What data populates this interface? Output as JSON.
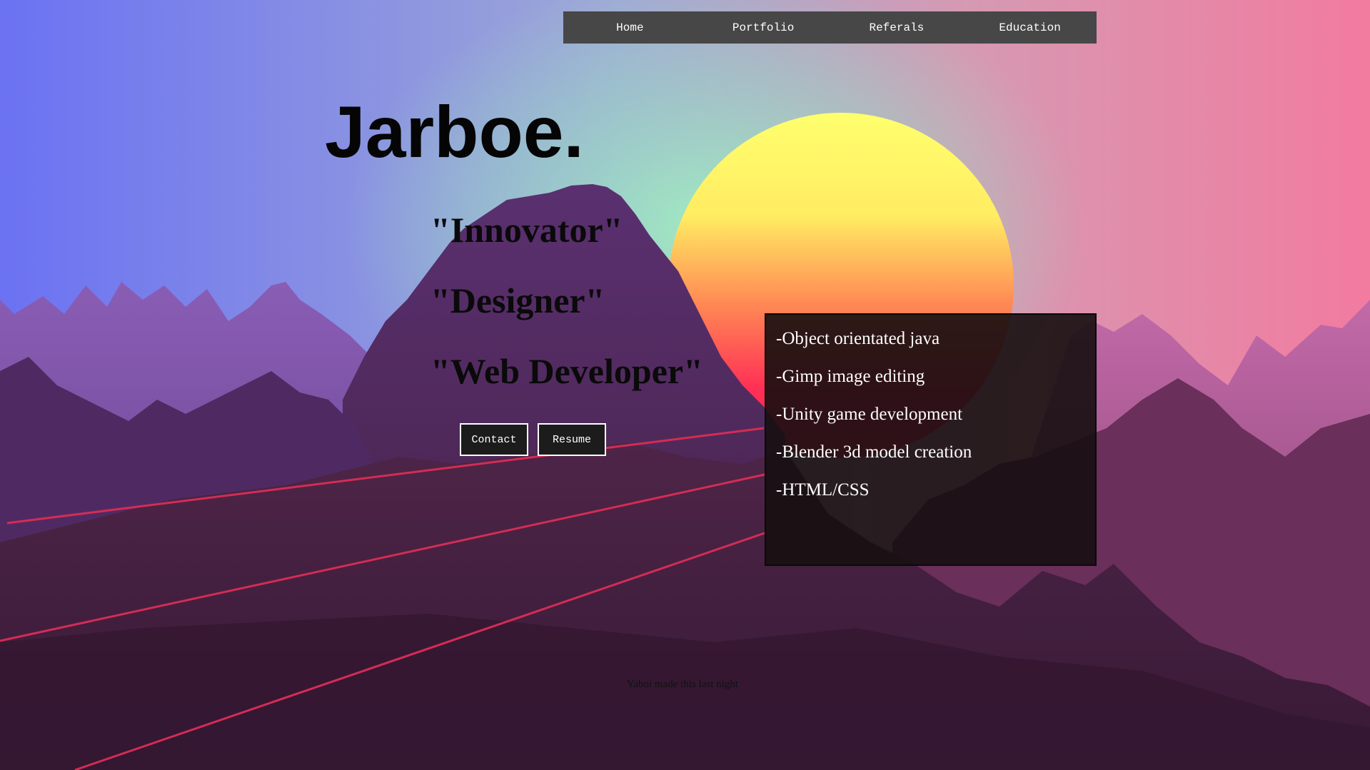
{
  "nav": {
    "items": [
      {
        "label": "Home"
      },
      {
        "label": "Portfolio"
      },
      {
        "label": "Referals"
      },
      {
        "label": "Education"
      }
    ]
  },
  "hero": {
    "title": "Jarboe.",
    "roles": [
      "\"Innovator\"",
      "\"Designer\"",
      "\"Web Developer\""
    ]
  },
  "buttons": {
    "contact": "Contact",
    "resume": "Resume"
  },
  "skills": [
    "-Object orientated java",
    "-Gimp image editing",
    "-Unity game development",
    "-Blender 3d model creation",
    "-HTML/CSS"
  ],
  "footer": {
    "text": "Yaboi made this last night"
  },
  "colors": {
    "nav_bg": "#474747",
    "sky_top_left": "#6a72f2",
    "sky_right": "#f07aa0",
    "sun_top": "#ffff70",
    "sun_bottom": "#ff2d55",
    "mountain_dark": "#3d1d3d",
    "laser_lines": "#d42c55",
    "panel_bg": "#1a1214"
  }
}
